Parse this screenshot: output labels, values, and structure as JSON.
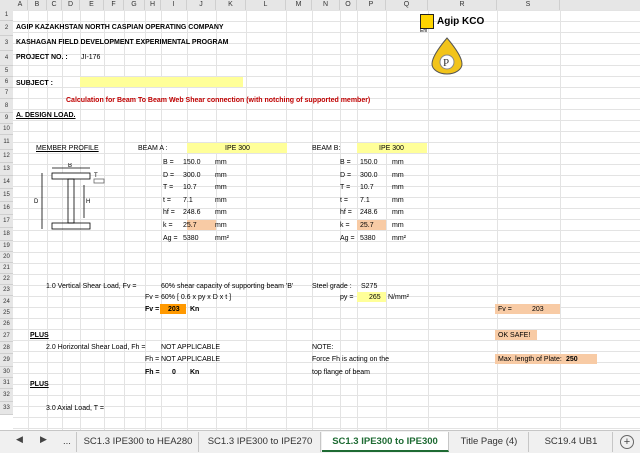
{
  "columns": [
    "A",
    "B",
    "C",
    "D",
    "E",
    "F",
    "G",
    "H",
    "I",
    "J",
    "K",
    "L",
    "M",
    "N",
    "O",
    "P",
    "Q",
    "R",
    "S"
  ],
  "rows": [
    "1",
    "2",
    "3",
    "4",
    "5",
    "6",
    "7",
    "8",
    "9",
    "10",
    "11",
    "12",
    "13",
    "14",
    "15",
    "16",
    "17",
    "18",
    "19",
    "20",
    "21",
    "22",
    "23",
    "24",
    "25",
    "26",
    "27",
    "28",
    "29",
    "30",
    "31",
    "32",
    "33"
  ],
  "header": {
    "company": "AGIP KAZAKHSTAN NORTH CASPIAN OPERATING COMPANY",
    "program": "KASHAGAN FIELD DEVELOPMENT EXPERIMENTAL PROGRAM",
    "project_label": "PROJECT NO.  :",
    "project_no": "JI-176",
    "subject_label": "SUBJECT     :",
    "logo_text": "Agip KCO",
    "logo_small": "Eni"
  },
  "title": "Calculation for Beam To Beam Web Shear connection (with notching of supported member)",
  "section_a": "A.  DESIGN LOAD.",
  "member_profile": "MEMBER PROFILE",
  "beam_a": {
    "label": "BEAM A :",
    "section": "IPE 300",
    "rows": [
      [
        "B =",
        "150.0",
        "mm"
      ],
      [
        "D =",
        "300.0",
        "mm"
      ],
      [
        "T =",
        "10.7",
        "mm"
      ],
      [
        "t =",
        "7.1",
        "mm"
      ],
      [
        "hf =",
        "248.6",
        "mm"
      ],
      [
        "k =",
        "25.7",
        "mm"
      ],
      [
        "Ag =",
        "5380",
        "mm²"
      ]
    ]
  },
  "beam_b": {
    "label": "BEAM B:",
    "section": "IPE 300",
    "rows": [
      [
        "B =",
        "150.0",
        "mm"
      ],
      [
        "D =",
        "300.0",
        "mm"
      ],
      [
        "T =",
        "10.7",
        "mm"
      ],
      [
        "t =",
        "7.1",
        "mm"
      ],
      [
        "hf =",
        "248.6",
        "mm"
      ],
      [
        "k =",
        "25.7",
        "mm"
      ],
      [
        "Ag =",
        "5380",
        "mm²"
      ]
    ]
  },
  "profile_labels": {
    "b": "B",
    "d": "D",
    "t": "T",
    "h": "H"
  },
  "load1": {
    "label": "1.0 Vertical Shear Load, Fv =",
    "desc": "60% shear capacity of supporting beam 'B'",
    "steel_label": "Steel grade :",
    "steel": "S275",
    "fv_label": "Fv =",
    "formula": "60% [ 0.6 x py x D x t ]",
    "py_label": "py =",
    "py": "265",
    "py_unit": "N/mm²",
    "fvb_label": "Fv =",
    "fv_value": "203",
    "fv_unit": "Kn"
  },
  "right_panel": {
    "fv_label": "Fv =",
    "fv_value": "203",
    "ok": "OK SAFE!",
    "max_len_label": "Max. length of Plate:",
    "max_len": "250"
  },
  "plus": "PLUS",
  "load2": {
    "label": "2.0 Horizontal Shear Load, Fh =",
    "value": "NOT APPLICABLE",
    "fh_label": "Fh =",
    "fh_value": "NOT APPLICABLE",
    "fhb_label": "Fh =",
    "fhb_value": "0",
    "fhb_unit": "Kn",
    "note": "NOTE:",
    "note1": "Force Fh is acting on the",
    "note2": "top flange of beam"
  },
  "plus2": "PLUS",
  "load3": {
    "label": "3.0 Axial Load, T ="
  },
  "tabs": [
    "...",
    "SC1.3  IPE300 to HEA280",
    "SC1.3  IPE300 to IPE270",
    "SC1.3  IPE300 to IPE300",
    "Title Page (4)",
    "SC19.4  UB1"
  ],
  "active_tab": "SC1.3  IPE300 to IPE300"
}
